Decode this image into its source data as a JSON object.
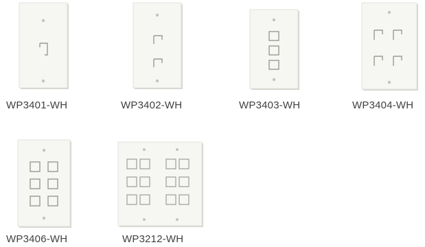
{
  "products": [
    {
      "model": "WP3401-WH"
    },
    {
      "model": "WP3402-WH"
    },
    {
      "model": "WP3403-WH"
    },
    {
      "model": "WP3404-WH"
    },
    {
      "model": "WP3406-WH"
    },
    {
      "model": "WP3212-WH"
    }
  ],
  "colors": {
    "plate_face": "#f6f6f3",
    "plate_edge": "#d8d8d2",
    "port_line": "#9a9a94",
    "caption_text": "#3f3f3f"
  }
}
